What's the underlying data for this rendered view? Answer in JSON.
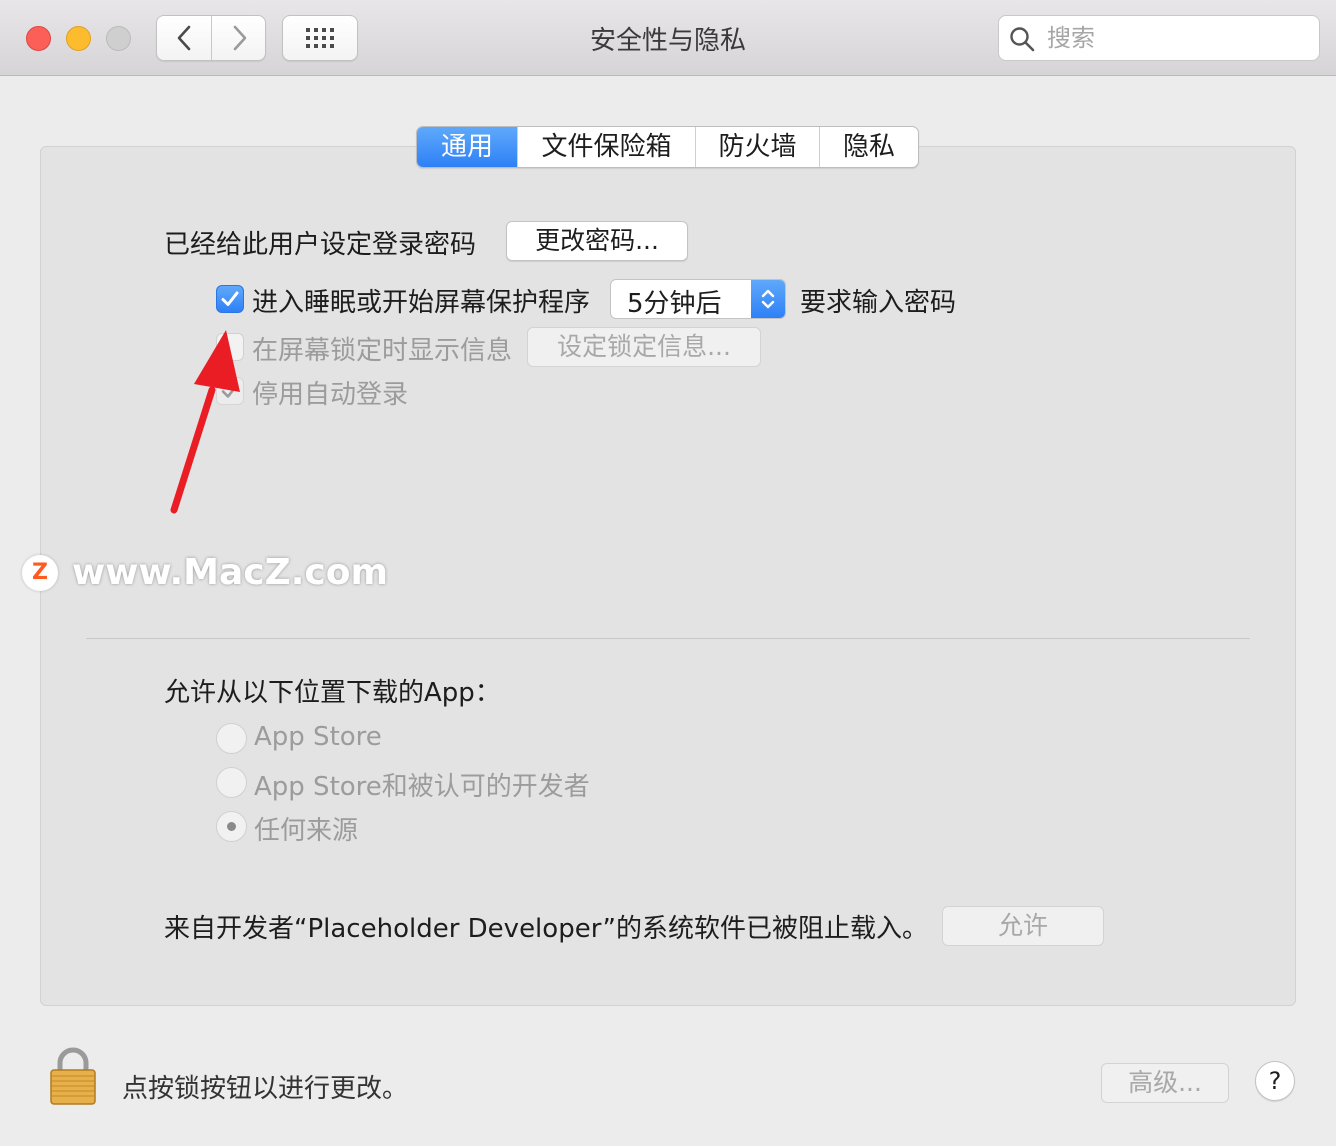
{
  "window": {
    "title": "安全性与隐私",
    "search_placeholder": "搜索"
  },
  "tabs": [
    {
      "label": "通用",
      "active": true
    },
    {
      "label": "文件保险箱",
      "active": false
    },
    {
      "label": "防火墙",
      "active": false
    },
    {
      "label": "隐私",
      "active": false
    }
  ],
  "general": {
    "password_set_text": "已经给此用户设定登录密码",
    "change_password_button": "更改密码...",
    "require_password_checkbox_label": "进入睡眠或开始屏幕保护程序",
    "require_password_checked": true,
    "delay_select_value": "5分钟后",
    "require_password_suffix": "要求输入密码",
    "show_message_label": "在屏幕锁定时显示信息",
    "show_message_checked": false,
    "set_lock_message_button": "设定锁定信息...",
    "disable_autologin_label": "停用自动登录",
    "disable_autologin_checked": true
  },
  "download_section": {
    "heading": "允许从以下位置下载的App：",
    "options": [
      {
        "label": "App Store",
        "selected": false
      },
      {
        "label": "App Store和被认可的开发者",
        "selected": false
      },
      {
        "label": "任何来源",
        "selected": true
      }
    ]
  },
  "blocked_software": {
    "text": "来自开发者“Placeholder Developer”的系统软件已被阻止载入。",
    "allow_button": "允许"
  },
  "footer": {
    "lock_text": "点按锁按钮以进行更改。",
    "advanced_button": "高级...",
    "help_button": "?"
  },
  "watermark": {
    "logo_letter": "Z",
    "text": "www.MacZ.com"
  },
  "colors": {
    "accent": "#2e80f6",
    "annotation_arrow": "#ea1c24",
    "close": "#fc5f57",
    "minimize": "#fdbc2e"
  }
}
